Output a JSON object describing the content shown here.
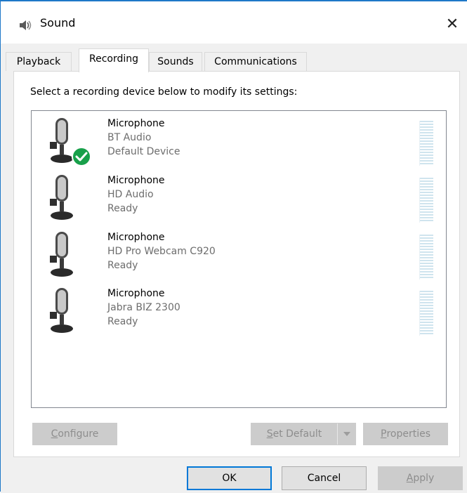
{
  "window": {
    "title": "Sound",
    "close_glyph": "✕"
  },
  "tabs": [
    {
      "label": "Playback",
      "active": false
    },
    {
      "label": "Recording",
      "active": true
    },
    {
      "label": "Sounds",
      "active": false
    },
    {
      "label": "Communications",
      "active": false
    }
  ],
  "recording": {
    "instruction": "Select a recording device below to modify its settings:",
    "devices": [
      {
        "name": "Microphone",
        "driver": "BT Audio",
        "status": "Default Device",
        "is_default": true
      },
      {
        "name": "Microphone",
        "driver": "HD Audio",
        "status": "Ready",
        "is_default": false
      },
      {
        "name": "Microphone",
        "driver": "HD Pro Webcam C920",
        "status": "Ready",
        "is_default": false
      },
      {
        "name": "Microphone",
        "driver": "Jabra BIZ 2300",
        "status": "Ready",
        "is_default": false
      }
    ],
    "buttons": {
      "configure_key": "C",
      "configure_rest": "onfigure",
      "set_default_key": "S",
      "set_default_rest": "et Default",
      "properties_key": "P",
      "properties_rest": "roperties"
    }
  },
  "dialog_buttons": {
    "ok": "OK",
    "cancel": "Cancel",
    "apply_key": "A",
    "apply_rest": "pply"
  },
  "icons": {
    "title": "speaker-icon",
    "device": "microphone-icon",
    "default_badge": "green-check-icon"
  },
  "colors": {
    "accent": "#0078d7",
    "check_green": "#18a04a",
    "meter": "#cfe4ee",
    "disabled_text": "#8d8d8d"
  }
}
